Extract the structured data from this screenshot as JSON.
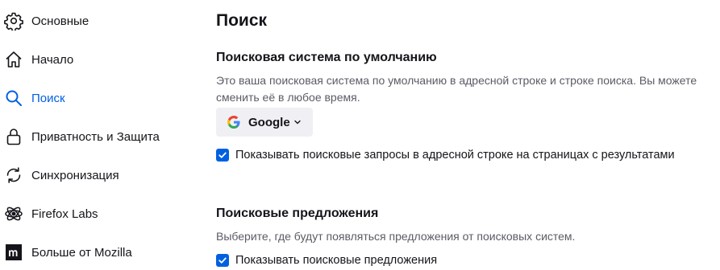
{
  "sidebar": {
    "items": [
      {
        "label": "Основные",
        "icon": "gear-icon"
      },
      {
        "label": "Начало",
        "icon": "home-icon"
      },
      {
        "label": "Поиск",
        "icon": "search-icon",
        "active": true
      },
      {
        "label": "Приватность и Защита",
        "icon": "lock-icon"
      },
      {
        "label": "Синхронизация",
        "icon": "sync-icon"
      },
      {
        "label": "Firefox Labs",
        "icon": "atom-icon"
      },
      {
        "label": "Больше от Mozilla",
        "icon": "mozilla-icon"
      }
    ],
    "active_color": "#0061e0"
  },
  "main": {
    "title": "Поиск",
    "default_engine": {
      "title": "Поисковая система по умолчанию",
      "description": "Это ваша поисковая система по умолчанию в адресной строке и строке поиска. Вы можете сменить её в любое время.",
      "engine_label": "Google",
      "show_search_terms_label": "Показывать поисковые запросы в адресной строке на страницах с результатами",
      "show_search_terms_checked": true
    },
    "suggestions": {
      "title": "Поисковые предложения",
      "description": "Выберите, где будут появляться предложения от поисковых систем.",
      "show_suggestions_label": "Показывать поисковые предложения",
      "show_suggestions_checked": true
    }
  }
}
